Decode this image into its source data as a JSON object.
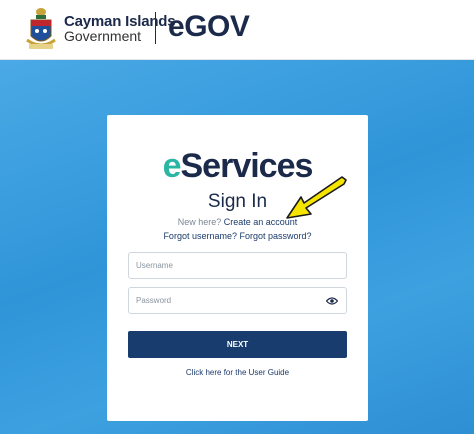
{
  "header": {
    "org_line1": "Cayman Islands",
    "org_line2": "Government",
    "product": "eGOV",
    "product_prefix": "e",
    "product_suffix": "GOV"
  },
  "card": {
    "brand_prefix": "e",
    "brand_suffix": "Services",
    "title": "Sign In",
    "new_here": "New here?",
    "create_account": "Create an account",
    "forgot_username": "Forgot username?",
    "forgot_password": "Forgot password?",
    "username_placeholder": "Username",
    "password_placeholder": "Password",
    "next_label": "NEXT",
    "user_guide": "Click here for the User Guide"
  },
  "icons": {
    "crest": "cayman-islands-coat-of-arms-icon",
    "eye": "eye-icon",
    "annotation": "yellow-arrow-icon"
  },
  "colors": {
    "navy": "#1b2a4a",
    "teal": "#2bb5a3",
    "button": "#173c6d",
    "background": "#3a9ad9",
    "arrow": "#f5e400"
  }
}
